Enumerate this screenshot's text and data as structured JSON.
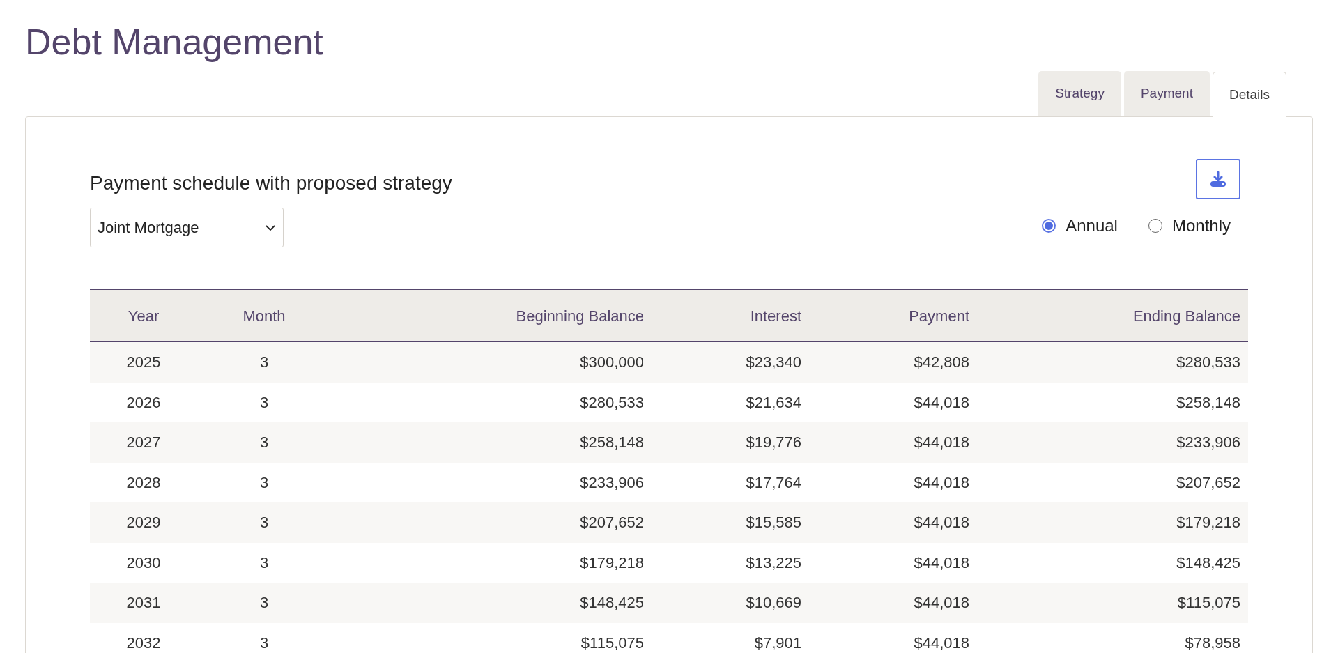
{
  "page": {
    "title": "Debt Management"
  },
  "tabs": [
    {
      "label": "Strategy",
      "selected": false
    },
    {
      "label": "Payment",
      "selected": false
    },
    {
      "label": "Details",
      "selected": true
    }
  ],
  "panel": {
    "heading": "Payment schedule with proposed strategy",
    "debt_select": {
      "value": "Joint Mortgage"
    },
    "period": [
      {
        "label": "Annual",
        "selected": true
      },
      {
        "label": "Monthly",
        "selected": false
      }
    ]
  },
  "table": {
    "columns": [
      "Year",
      "Month",
      "Beginning Balance",
      "Interest",
      "Payment",
      "Ending Balance"
    ],
    "rows": [
      [
        "2025",
        "3",
        "$300,000",
        "$23,340",
        "$42,808",
        "$280,533"
      ],
      [
        "2026",
        "3",
        "$280,533",
        "$21,634",
        "$44,018",
        "$258,148"
      ],
      [
        "2027",
        "3",
        "$258,148",
        "$19,776",
        "$44,018",
        "$233,906"
      ],
      [
        "2028",
        "3",
        "$233,906",
        "$17,764",
        "$44,018",
        "$207,652"
      ],
      [
        "2029",
        "3",
        "$207,652",
        "$15,585",
        "$44,018",
        "$179,218"
      ],
      [
        "2030",
        "3",
        "$179,218",
        "$13,225",
        "$44,018",
        "$148,425"
      ],
      [
        "2031",
        "3",
        "$148,425",
        "$10,669",
        "$44,018",
        "$115,075"
      ],
      [
        "2032",
        "3",
        "$115,075",
        "$7,901",
        "$44,018",
        "$78,958"
      ]
    ]
  }
}
